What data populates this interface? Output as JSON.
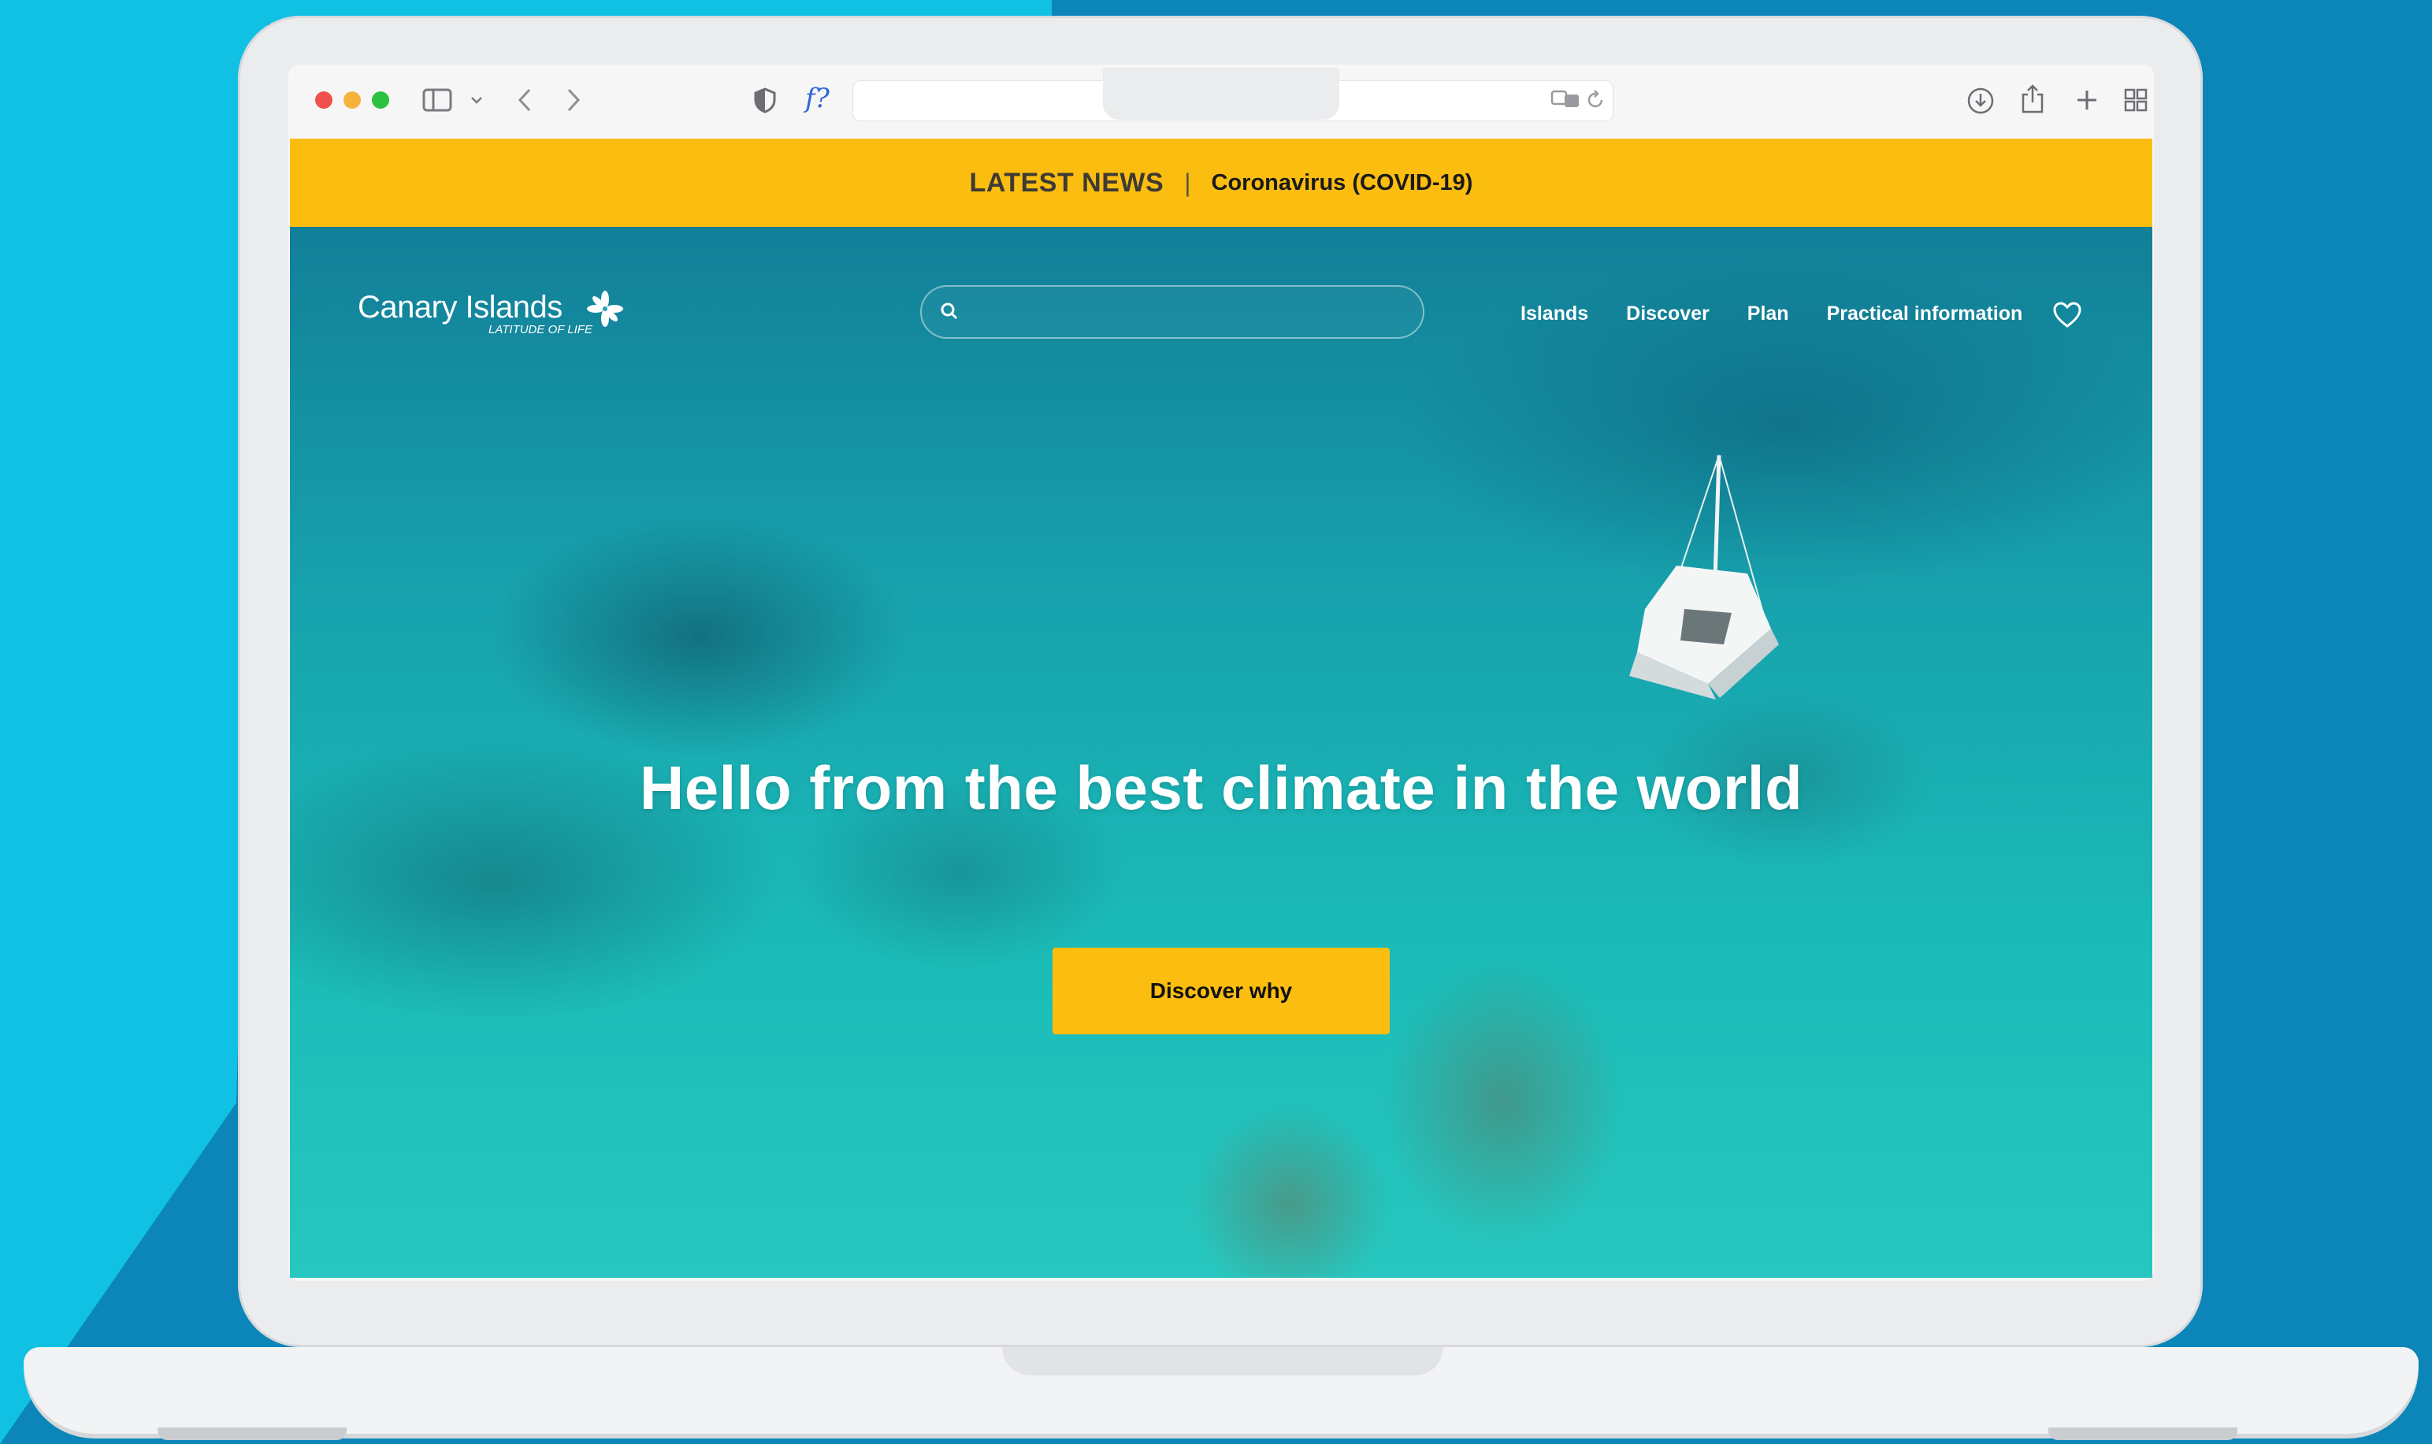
{
  "news": {
    "label": "LATEST NEWS",
    "link": "Coronavirus (COVID-19)"
  },
  "brand": {
    "name": "Canary Islands",
    "tagline": "LATITUDE OF LIFE"
  },
  "search": {
    "placeholder": ""
  },
  "nav": {
    "items": [
      {
        "label": "Islands"
      },
      {
        "label": "Discover"
      },
      {
        "label": "Plan"
      },
      {
        "label": "Practical information"
      }
    ]
  },
  "hero": {
    "headline": "Hello from the best climate in the world",
    "cta_label": "Discover why"
  },
  "browser": {
    "font_icon_label": "f?"
  },
  "colors": {
    "accent_yellow": "#fbbd10",
    "backdrop_light": "#10c1e3",
    "backdrop_dark": "#0c86b8"
  }
}
